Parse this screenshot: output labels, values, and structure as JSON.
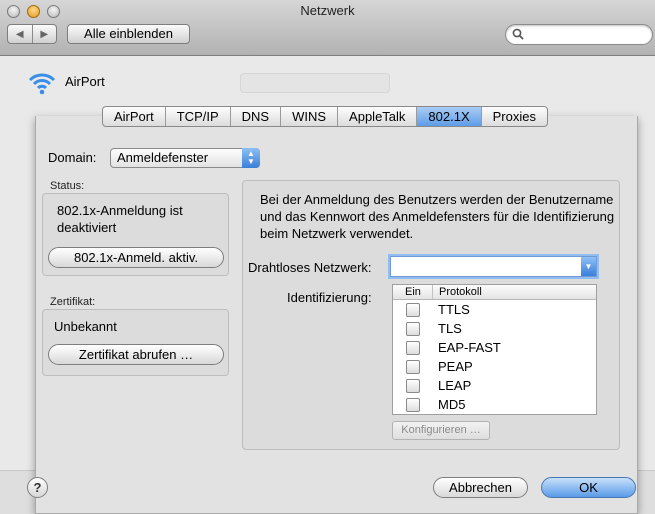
{
  "window": {
    "title": "Netzwerk"
  },
  "toolbar": {
    "back_icon": "back-arrow-icon",
    "forward_icon": "forward-arrow-icon",
    "show_all_label": "Alle einblenden",
    "search_placeholder": ""
  },
  "header": {
    "interface_name": "AirPort"
  },
  "tabs": [
    {
      "label": "AirPort",
      "selected": false
    },
    {
      "label": "TCP/IP",
      "selected": false
    },
    {
      "label": "DNS",
      "selected": false
    },
    {
      "label": "WINS",
      "selected": false
    },
    {
      "label": "AppleTalk",
      "selected": false
    },
    {
      "label": "802.1X",
      "selected": true
    },
    {
      "label": "Proxies",
      "selected": false
    }
  ],
  "domain": {
    "label": "Domain:",
    "value": "Anmeldefenster"
  },
  "status": {
    "group_label": "Status:",
    "text": "802.1x-Anmeldung ist deaktiviert",
    "button_label": "802.1x-Anmeld. aktiv."
  },
  "certificate": {
    "group_label": "Zertifikat:",
    "text": "Unbekannt",
    "button_label": "Zertifikat abrufen …"
  },
  "right_panel": {
    "description": "Bei der Anmeldung des Benutzers werden der Benutzername und das Kennwort des Anmeldefensters für die Identifizierung beim Netzwerk verwendet.",
    "wireless_label": "Drahtloses Netzwerk:",
    "wireless_value": "",
    "auth_label": "Identifizierung:",
    "table_headers": {
      "on": "Ein",
      "protocol": "Protokoll"
    },
    "protocols": [
      {
        "name": "TTLS",
        "enabled": false
      },
      {
        "name": "TLS",
        "enabled": false
      },
      {
        "name": "EAP-FAST",
        "enabled": false
      },
      {
        "name": "PEAP",
        "enabled": false
      },
      {
        "name": "LEAP",
        "enabled": false
      },
      {
        "name": "MD5",
        "enabled": false
      }
    ],
    "configure_label": "Konfigurieren …"
  },
  "footer": {
    "cancel_label": "Abbrechen",
    "ok_label": "OK",
    "help_label": "?"
  },
  "colors": {
    "selection_blue": "#5e9ce6",
    "window_bg": "#e8e8e8"
  }
}
